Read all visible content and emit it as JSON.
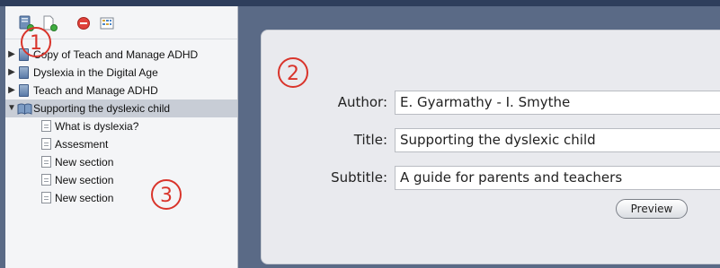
{
  "toolbar": {
    "buttons": [
      {
        "icon": "new-book-icon"
      },
      {
        "icon": "new-page-icon"
      },
      {
        "icon": "delete-icon"
      },
      {
        "icon": "grid-view-icon"
      }
    ]
  },
  "tree": {
    "books": [
      {
        "label": "Copy of Teach and Manage ADHD",
        "expanded": false
      },
      {
        "label": "Dyslexia in the Digital Age",
        "expanded": false
      },
      {
        "label": "Teach and Manage ADHD",
        "expanded": false
      },
      {
        "label": "Supporting the dyslexic child",
        "expanded": true,
        "selected": true
      }
    ],
    "children": [
      {
        "label": "What is dyslexia?"
      },
      {
        "label": "Assesment"
      },
      {
        "label": "New section"
      },
      {
        "label": "New section"
      },
      {
        "label": "New section"
      }
    ]
  },
  "form": {
    "author_label": "Author:",
    "author_value": "E. Gyarmathy - I. Smythe",
    "title_label": "Title:",
    "title_value": "Supporting the dyslexic child",
    "subtitle_label": "Subtitle:",
    "subtitle_value": "A guide for parents and teachers",
    "preview_label": "Preview"
  },
  "callouts": {
    "one": "1",
    "two": "2",
    "three": "3"
  },
  "colors": {
    "callout": "#d9342b",
    "selection": "#c8cdd6",
    "background": "#5a6a86"
  }
}
